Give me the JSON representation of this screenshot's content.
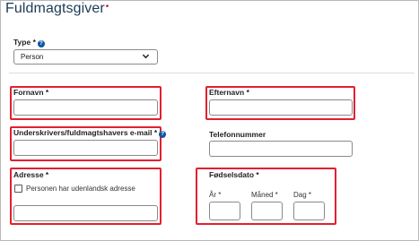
{
  "section": {
    "title": "Fuldmagtsgiver",
    "required_mark": "•"
  },
  "type_field": {
    "label": "Type *",
    "help": "?",
    "value": "Person",
    "dropdown_icon": "chevron-down"
  },
  "fornavn": {
    "label": "Fornavn *",
    "value": ""
  },
  "efternavn": {
    "label": "Efternavn *",
    "value": ""
  },
  "email": {
    "label": "Underskrivers/fuldmagtshavers e-mail *",
    "help": "?",
    "value": ""
  },
  "telefon": {
    "label": "Telefonnummer",
    "value": ""
  },
  "adresse": {
    "label": "Adresse *",
    "checkbox_label": "Personen har udenlandsk adresse",
    "checkbox_checked": false,
    "value": ""
  },
  "foedselsdato": {
    "label": "Fødselsdato *",
    "year_label": "År *",
    "month_label": "Måned *",
    "day_label": "Dag *"
  },
  "colors": {
    "title": "#1b3a57",
    "highlight": "#e2202f",
    "help_icon": "#0b56a5"
  }
}
